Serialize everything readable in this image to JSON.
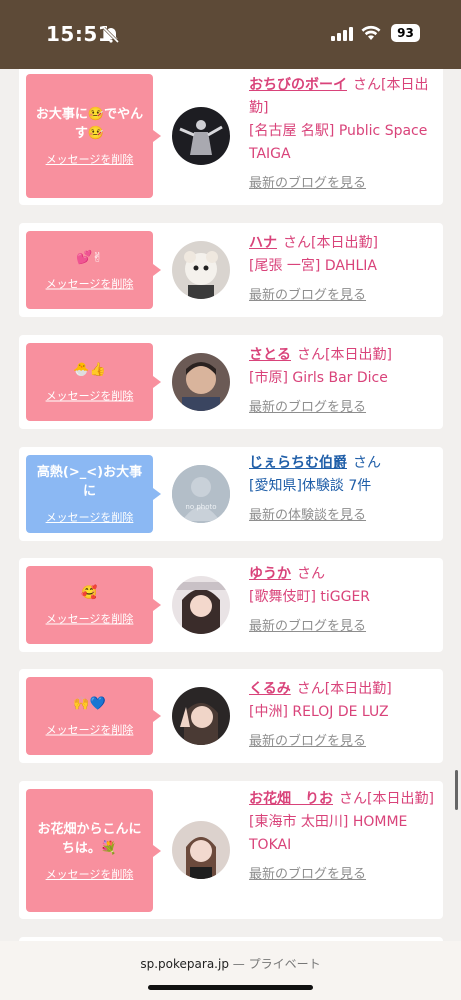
{
  "status": {
    "time": "15:51",
    "battery": "93"
  },
  "cards": [
    {
      "message": "お大事に🤒でやんす🤒",
      "delete": "メッセージを削除",
      "name": "おちびのボーイ",
      "san": "さん",
      "status": "[本日出勤]",
      "shop": "[名古屋 名駅] Public Space TAIGA",
      "more": "最新のブログを見る"
    },
    {
      "message": "💕✌",
      "delete": "メッセージを削除",
      "name": "ハナ",
      "san": "さん",
      "status": "[本日出勤]",
      "shop": "[尾張 一宮] DAHLIA",
      "more": "最新のブログを見る"
    },
    {
      "message": "🐣👍",
      "delete": "メッセージを削除",
      "name": "さとる",
      "san": "さん",
      "status": "[本日出勤]",
      "shop": "[市原] Girls Bar Dice",
      "more": "最新のブログを見る"
    },
    {
      "message": "高熱(>_<)お大事に",
      "delete": "メッセージを削除",
      "name": "じぇらちむ伯爵",
      "san": "さん",
      "status": "",
      "shop": "[愛知県]体験談 7件",
      "more": "最新の体験談を見る",
      "avatar_text": "no photo"
    },
    {
      "message": "🥰",
      "delete": "メッセージを削除",
      "name": "ゆうか",
      "san": "さん",
      "status": "",
      "shop": "[歌舞伎町] tiGGER",
      "more": "最新のブログを見る"
    },
    {
      "message": "🙌💙",
      "delete": "メッセージを削除",
      "name": "くるみ",
      "san": "さん",
      "status": "[本日出勤]",
      "shop": "[中洲] RELOJ DE LUZ",
      "more": "最新のブログを見る"
    },
    {
      "message": "お花畑からこんにちは。💐",
      "delete": "メッセージを削除",
      "name": "お花畑　りお",
      "san": "さん",
      "status": "[本日出勤]",
      "shop": "[東海市 太田川] HOMME TOKAI",
      "more": "最新のブログを見る"
    }
  ],
  "browser": {
    "url": "sp.pokepara.jp",
    "separator": " — ",
    "mode": "プライベート"
  }
}
